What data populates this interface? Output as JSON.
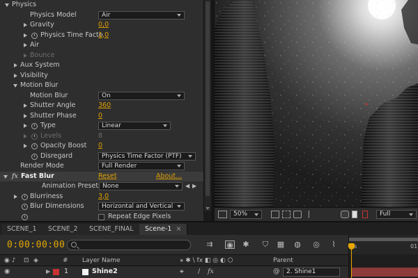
{
  "effect_controls": {
    "physics": {
      "label": "Physics",
      "model_label": "Physics Model",
      "model_value": "Air",
      "gravity_label": "Gravity",
      "gravity_value": "0,0",
      "ptf_label": "Physics Time Facto",
      "ptf_value": "1,0",
      "air_label": "Air",
      "bounce_label": "Bounce"
    },
    "aux_system_label": "Aux System",
    "visibility_label": "Visibility",
    "motion_blur": {
      "label": "Motion Blur",
      "mb_label": "Motion Blur",
      "mb_value": "On",
      "shutter_angle_label": "Shutter Angle",
      "shutter_angle_value": "360",
      "shutter_phase_label": "Shutter Phase",
      "shutter_phase_value": "0",
      "type_label": "Type",
      "type_value": "Linear",
      "levels_label": "Levels",
      "levels_value": "8",
      "opacity_boost_label": "Opacity Boost",
      "opacity_boost_value": "0",
      "disregard_label": "Disregard",
      "disregard_value": "Physics Time Factor (PTF)"
    },
    "render_mode_label": "Render Mode",
    "render_mode_value": "Full Render",
    "fast_blur": {
      "fx_symbol": "fx",
      "label": "Fast Blur",
      "reset_label": "Reset",
      "about_label": "About...",
      "presets_label": "Animation Presets:",
      "presets_value": "None",
      "blurriness_label": "Blurriness",
      "blurriness_value": "3,0",
      "blur_dimensions_label": "Blur Dimensions",
      "blur_dimensions_value": "Horizontal and Vertical",
      "repeat_edge_label": "Repeat Edge Pixels"
    }
  },
  "viewer": {
    "zoom_value": "50%",
    "resolution_value": "Full"
  },
  "timeline": {
    "tabs": [
      {
        "label": "SCENE_1",
        "active": false
      },
      {
        "label": "SCENE_2",
        "active": false
      },
      {
        "label": "SCENE_FINAL",
        "active": false
      },
      {
        "label": "Scene-1",
        "active": true
      }
    ],
    "tab_close_glyph": "×",
    "timecode": "0:00:00:00",
    "ruler_start": "0s",
    "ruler_end": "01",
    "columns": {
      "layer_name": "Layer Name",
      "switches": "⚹ ✱ \\ fx ◧ ◎ ◐ ⬡",
      "parent": "Parent"
    },
    "layer": {
      "number": "1",
      "name": "Shine2",
      "parent_value": "2. Shine1",
      "label_color": "#c83232",
      "bar_color": "#8c3a3a"
    }
  },
  "colors": {
    "value_accent": "#e0a000",
    "timecode": "#e4a800",
    "panel_bg": "#2e2e2e"
  }
}
